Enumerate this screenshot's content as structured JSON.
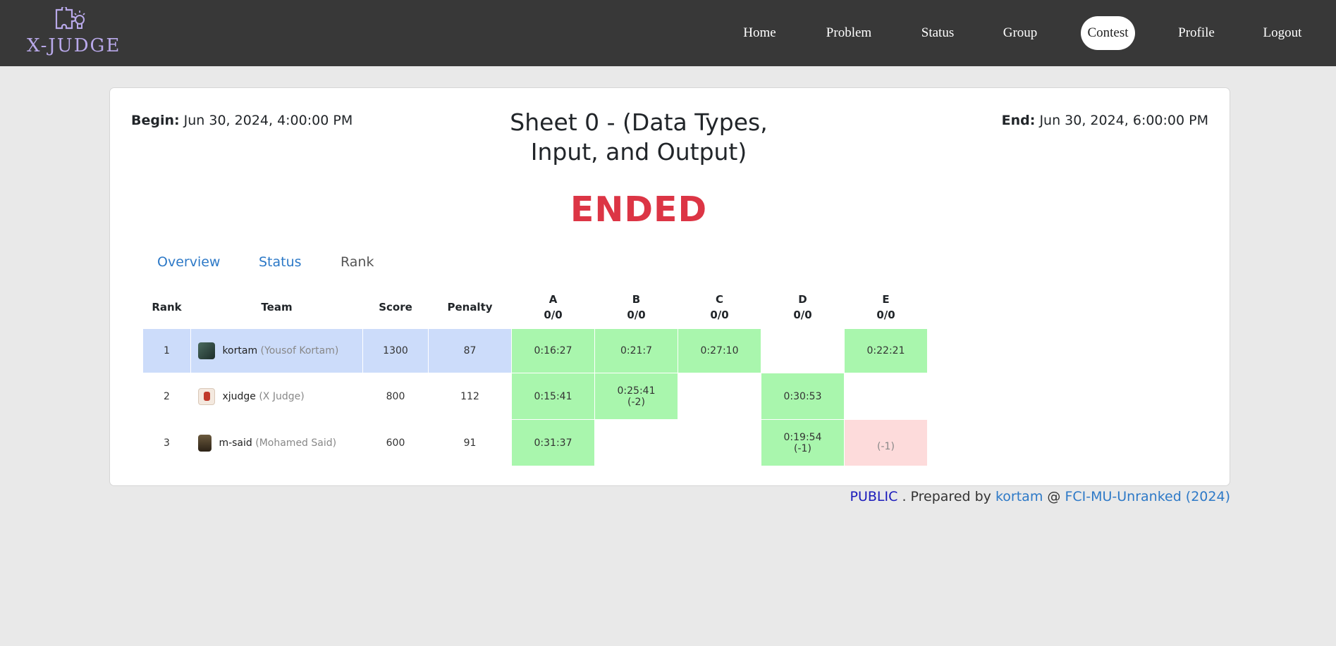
{
  "brand": {
    "name": "X-JUDGE",
    "icon": "puzzle-lightbulb-icon"
  },
  "nav": {
    "home": "Home",
    "problem": "Problem",
    "status": "Status",
    "group": "Group",
    "contest": "Contest",
    "profile": "Profile",
    "logout": "Logout"
  },
  "contest": {
    "begin_label": "Begin:",
    "begin_value": "Jun 30, 2024, 4:00:00 PM",
    "end_label": "End:",
    "end_value": "Jun 30, 2024, 6:00:00 PM",
    "title": "Sheet 0 - (Data Types, Input, and Output)",
    "state": "ENDED",
    "state_color": "#dc3545"
  },
  "tabs": {
    "overview": "Overview",
    "status": "Status",
    "rank": "Rank"
  },
  "table": {
    "headers": {
      "rank": "Rank",
      "team": "Team",
      "score": "Score",
      "penalty": "Penalty",
      "problems": [
        {
          "letter": "A",
          "solved": "0/0"
        },
        {
          "letter": "B",
          "solved": "0/0"
        },
        {
          "letter": "C",
          "solved": "0/0"
        },
        {
          "letter": "D",
          "solved": "0/0"
        },
        {
          "letter": "E",
          "solved": "0/0"
        }
      ]
    },
    "rows": [
      {
        "rank": "1",
        "user": "kortam",
        "name": "(Yousof Kortam)",
        "score": "1300",
        "penalty": "87",
        "A": {
          "time": "0:16:27",
          "tries": ""
        },
        "B": {
          "time": "0:21:7",
          "tries": ""
        },
        "C": {
          "time": "0:27:10",
          "tries": ""
        },
        "D": {
          "time": "",
          "tries": ""
        },
        "E": {
          "time": "0:22:21",
          "tries": ""
        }
      },
      {
        "rank": "2",
        "user": "xjudge",
        "name": "(X Judge)",
        "score": "800",
        "penalty": "112",
        "A": {
          "time": "0:15:41",
          "tries": ""
        },
        "B": {
          "time": "0:25:41",
          "tries": "(-2)"
        },
        "C": {
          "time": "",
          "tries": ""
        },
        "D": {
          "time": "0:30:53",
          "tries": ""
        },
        "E": {
          "time": "",
          "tries": ""
        }
      },
      {
        "rank": "3",
        "user": "m-said",
        "name": "(Mohamed Said)",
        "score": "600",
        "penalty": "91",
        "A": {
          "time": "0:31:37",
          "tries": ""
        },
        "B": {
          "time": "",
          "tries": ""
        },
        "C": {
          "time": "",
          "tries": ""
        },
        "D": {
          "time": "0:19:54",
          "tries": "(-1)"
        },
        "E": {
          "time": "",
          "tries": "(-1)"
        }
      }
    ],
    "colors": {
      "highlight": "#ccdcfa",
      "accepted": "#a9f6ad",
      "wrong": "#fddbdb"
    }
  },
  "footer": {
    "visibility": "PUBLIC",
    "prepared_by": ". Prepared by",
    "author": "kortam",
    "at": "@",
    "group": "FCI-MU-Unranked (2024)"
  }
}
